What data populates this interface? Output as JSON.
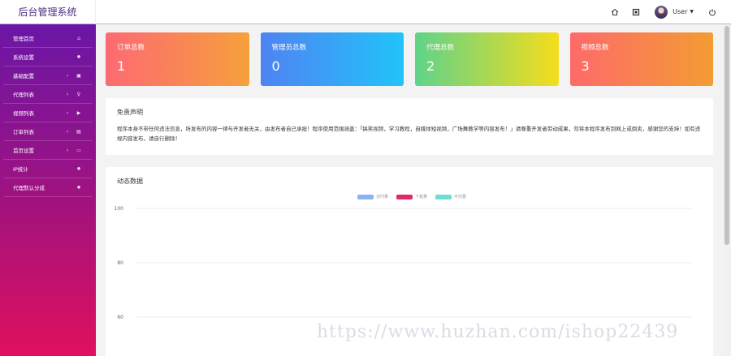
{
  "brand": "后台管理系统",
  "topbar": {
    "home_icon": "home-icon",
    "fullscreen_icon": "fullscreen-icon",
    "user_name": "User",
    "logout_icon": "power-icon"
  },
  "sidebar": {
    "items": [
      {
        "label": "管理首页",
        "icon": "home-icon"
      },
      {
        "label": "系统设置",
        "icon": "gear-icon"
      },
      {
        "label": "基础配置",
        "icon": "calendar-icon"
      },
      {
        "label": "代理列表",
        "icon": "user-icon"
      },
      {
        "label": "视频列表",
        "icon": "play-icon"
      },
      {
        "label": "订单列表",
        "icon": "clipboard-icon"
      },
      {
        "label": "首页设置",
        "icon": "monitor-icon"
      },
      {
        "label": "IP统计",
        "icon": "gear-icon"
      },
      {
        "label": "代理默认分成",
        "icon": "gear-icon"
      }
    ]
  },
  "stats": [
    {
      "title": "订单总数",
      "value": "1"
    },
    {
      "title": "管理员总数",
      "value": "0"
    },
    {
      "title": "代理总数",
      "value": "2"
    },
    {
      "title": "视频总数",
      "value": "3"
    }
  ],
  "notice": {
    "title": "免责声明",
    "text": "程序本身不带任何违法信息，所发布的内容一律与开发者无关，由发布者自己承担！程序使用范围涵盖：「搞笑视频，学习教程，自媒体短视频，广场舞教学等内容发布！」请尊重开发者劳动成果，勿将本程序发布到网上或倒卖，感谢您的支持！如有违规内容发布，请自行删除！"
  },
  "chart_panel": {
    "title": "动态数据"
  },
  "chart_data": {
    "type": "line",
    "title": "",
    "series": [
      {
        "name": "访问量",
        "color": "#8cb4ec",
        "values": []
      },
      {
        "name": "下载量",
        "color": "#e0286a",
        "values": []
      },
      {
        "name": "平均量",
        "color": "#6fdcd6",
        "values": []
      }
    ],
    "y_ticks": [
      "100",
      "80",
      "60"
    ],
    "ylim": [
      60,
      100
    ],
    "grid": true,
    "legend": "top-center"
  },
  "watermark": "https://www.huzhan.com/ishop22439"
}
